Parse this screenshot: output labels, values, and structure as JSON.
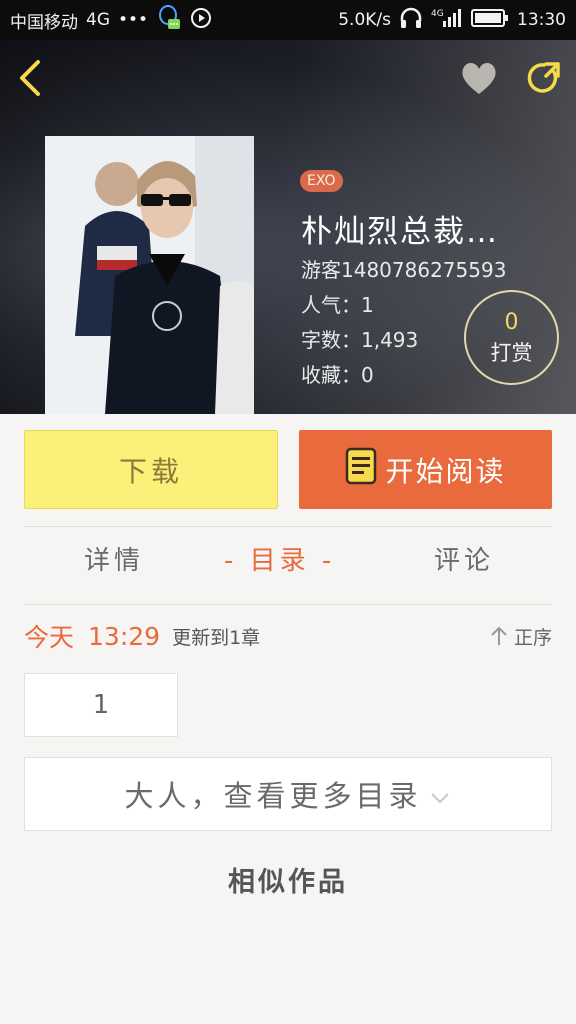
{
  "status_bar": {
    "carrier": "中国移动",
    "network": "4G",
    "dots": "•••",
    "speed": "5.0K/s",
    "signal_label": "4G",
    "time": "13:30"
  },
  "header": {
    "back_icon": "chevron-left-icon",
    "favorite_icon": "heart-icon",
    "share_icon": "share-icon"
  },
  "book": {
    "tag": "EXO",
    "title": "朴灿烈总裁…",
    "author": "游客1480786275593",
    "popularity": "人气：1",
    "word_count": "字数：1,493",
    "favorites": "收藏：0"
  },
  "tip": {
    "count": "0",
    "label": "打赏"
  },
  "actions": {
    "download_label": "下载",
    "read_label": "开始阅读"
  },
  "tabs": [
    {
      "label": "详情"
    },
    {
      "label": "- 目录 -",
      "active": true
    },
    {
      "label": "评论"
    }
  ],
  "update": {
    "day": "今天",
    "time": "13:29",
    "text": "更新到1章",
    "sort_label": "正序"
  },
  "chapters": [
    "1"
  ],
  "more_catalog": "大人，查看更多目录",
  "similar_title": "相似作品",
  "colors": {
    "accent": "#e96a3c",
    "download": "#fbf07a",
    "tip_count": "#f0d86a"
  }
}
